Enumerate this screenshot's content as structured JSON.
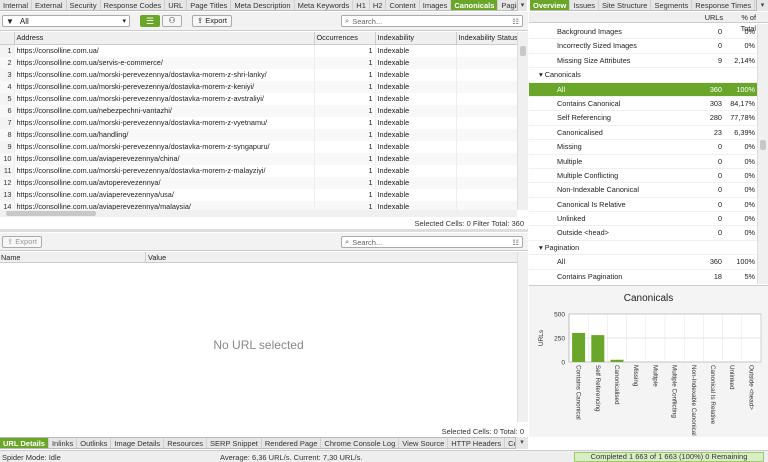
{
  "left_tabs": [
    "Internal",
    "External",
    "Security",
    "Response Codes",
    "URL",
    "Page Titles",
    "Meta Description",
    "Meta Keywords",
    "H1",
    "H2",
    "Content",
    "Images",
    "Canonicals",
    "Pagin"
  ],
  "left_active_tab": "Canonicals",
  "right_tabs": [
    "Overview",
    "Issues",
    "Site Structure",
    "Segments",
    "Response Times"
  ],
  "right_active_tab": "Overview",
  "filter": {
    "value": "All",
    "export": "Export",
    "search_placeholder": "Search..."
  },
  "table": {
    "headers": [
      "Address",
      "Occurrences",
      "Indexability",
      "Indexability Status"
    ],
    "rows": [
      {
        "n": "1",
        "url": "https://consolline.com.ua/",
        "occ": "1",
        "idx": "Indexable"
      },
      {
        "n": "2",
        "url": "https://consolline.com.ua/servis-e-commerce/",
        "occ": "1",
        "idx": "Indexable"
      },
      {
        "n": "3",
        "url": "https://consolline.com.ua/morski-perevezennya/dostavka-morem-z-shri-lanky/",
        "occ": "1",
        "idx": "Indexable"
      },
      {
        "n": "4",
        "url": "https://consolline.com.ua/morski-perevezennya/dostavka-morem-z-keniyi/",
        "occ": "1",
        "idx": "Indexable"
      },
      {
        "n": "5",
        "url": "https://consolline.com.ua/morski-perevezennya/dostavka-morem-z-avstraliyi/",
        "occ": "1",
        "idx": "Indexable"
      },
      {
        "n": "6",
        "url": "https://consolline.com.ua/nebezpechni-vantazhi/",
        "occ": "1",
        "idx": "Indexable"
      },
      {
        "n": "7",
        "url": "https://consolline.com.ua/morski-perevezennya/dostavka-morem-z-vyetnamu/",
        "occ": "1",
        "idx": "Indexable"
      },
      {
        "n": "8",
        "url": "https://consolline.com.ua/handling/",
        "occ": "1",
        "idx": "Indexable"
      },
      {
        "n": "9",
        "url": "https://consolline.com.ua/morski-perevezennya/dostavka-morem-z-syngapuru/",
        "occ": "1",
        "idx": "Indexable"
      },
      {
        "n": "10",
        "url": "https://consolline.com.ua/aviaperevezennya/china/",
        "occ": "1",
        "idx": "Indexable"
      },
      {
        "n": "11",
        "url": "https://consolline.com.ua/morski-perevezennya/dostavka-morem-z-malayziyi/",
        "occ": "1",
        "idx": "Indexable"
      },
      {
        "n": "12",
        "url": "https://consolline.com.ua/avtoperevezennya/",
        "occ": "1",
        "idx": "Indexable"
      },
      {
        "n": "13",
        "url": "https://consolline.com.ua/aviaperevezennya/usa/",
        "occ": "1",
        "idx": "Indexable"
      },
      {
        "n": "14",
        "url": "https://consolline.com.ua/aviaperevezennya/malaysia/",
        "occ": "1",
        "idx": "Indexable"
      }
    ],
    "status": "Selected Cells:  0  Filter Total:  360"
  },
  "lower": {
    "export": "Export",
    "search_placeholder": "Search...",
    "headers": [
      "Name",
      "Value"
    ],
    "empty": "No URL selected",
    "status": "Selected Cells:  0  Total:  0"
  },
  "bottom_tabs": [
    "URL Details",
    "Inlinks",
    "Outlinks",
    "Image Details",
    "Resources",
    "SERP Snippet",
    "Rendered Page",
    "Chrome Console Log",
    "View Source",
    "HTTP Headers",
    "Cooki"
  ],
  "bottom_active": "URL Details",
  "statusbar": {
    "mode": "Spider Mode: Idle",
    "avg": "Average: 6,36 URL/s. Current: 7,30 URL/s.",
    "completed": "Completed 1 663 of 1 663 (100%) 0 Remaining"
  },
  "overview": {
    "headers": [
      "URLs",
      "% of Total"
    ],
    "rows": [
      {
        "label": "Background Images",
        "n": "0",
        "p": "0%"
      },
      {
        "label": "Incorrectly Sized Images",
        "n": "0",
        "p": "0%"
      },
      {
        "label": "Missing Size Attributes",
        "n": "9",
        "p": "2,14%"
      },
      {
        "label": "Canonicals",
        "section": true
      },
      {
        "label": "All",
        "n": "360",
        "p": "100%",
        "sel": true
      },
      {
        "label": "Contains Canonical",
        "n": "303",
        "p": "84,17%"
      },
      {
        "label": "Self Referencing",
        "n": "280",
        "p": "77,78%"
      },
      {
        "label": "Canonicalised",
        "n": "23",
        "p": "6,39%"
      },
      {
        "label": "Missing",
        "n": "0",
        "p": "0%"
      },
      {
        "label": "Multiple",
        "n": "0",
        "p": "0%"
      },
      {
        "label": "Multiple Conflicting",
        "n": "0",
        "p": "0%"
      },
      {
        "label": "Non-Indexable Canonical",
        "n": "0",
        "p": "0%"
      },
      {
        "label": "Canonical Is Relative",
        "n": "0",
        "p": "0%"
      },
      {
        "label": "Unlinked",
        "n": "0",
        "p": "0%"
      },
      {
        "label": "Outside <head>",
        "n": "0",
        "p": "0%"
      },
      {
        "label": "Pagination",
        "section": true
      },
      {
        "label": "All",
        "n": "360",
        "p": "100%"
      },
      {
        "label": "Contains Pagination",
        "n": "18",
        "p": "5%"
      }
    ]
  },
  "chart_data": {
    "type": "bar",
    "title": "Canonicals",
    "ylabel": "URLs",
    "ylim": [
      0,
      500
    ],
    "yticks": [
      "500",
      "250",
      "0"
    ],
    "categories": [
      "Contains Canonical",
      "Self Referencing",
      "Canonicalised",
      "Missing",
      "Multiple",
      "Multiple Conflicting",
      "Non-Indexable Canonical",
      "Canonical Is Relative",
      "Unlinked",
      "Outside <head>"
    ],
    "values": [
      303,
      280,
      23,
      0,
      0,
      0,
      0,
      0,
      0,
      0
    ],
    "color": "#6aa62a"
  }
}
